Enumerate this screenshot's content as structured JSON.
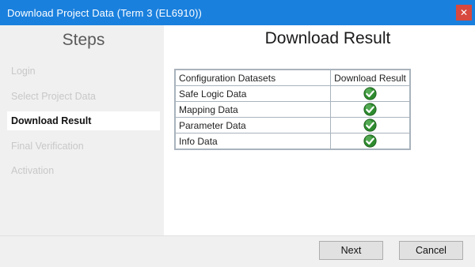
{
  "window": {
    "title": "Download Project Data (Term 3 (EL6910))",
    "close_glyph": "✕"
  },
  "steps": {
    "heading": "Steps",
    "items": [
      {
        "label": "Login",
        "active": false
      },
      {
        "label": "Select Project Data",
        "active": false
      },
      {
        "label": "Download Result",
        "active": true
      },
      {
        "label": "Final Verification",
        "active": false
      },
      {
        "label": "Activation",
        "active": false
      }
    ]
  },
  "main": {
    "title": "Download Result",
    "table": {
      "headers": [
        "Configuration Datasets",
        "Download Result"
      ],
      "rows": [
        {
          "name": "Safe Logic Data",
          "result": "check-icon"
        },
        {
          "name": "Mapping Data",
          "result": "check-icon"
        },
        {
          "name": "Parameter Data",
          "result": "check-icon"
        },
        {
          "name": "Info Data",
          "result": "check-icon"
        }
      ]
    }
  },
  "footer": {
    "next_label": "Next",
    "cancel_label": "Cancel"
  },
  "colors": {
    "titlebar": "#1a80de",
    "close_button": "#d7483e",
    "check_green": "#2e8b2e"
  }
}
